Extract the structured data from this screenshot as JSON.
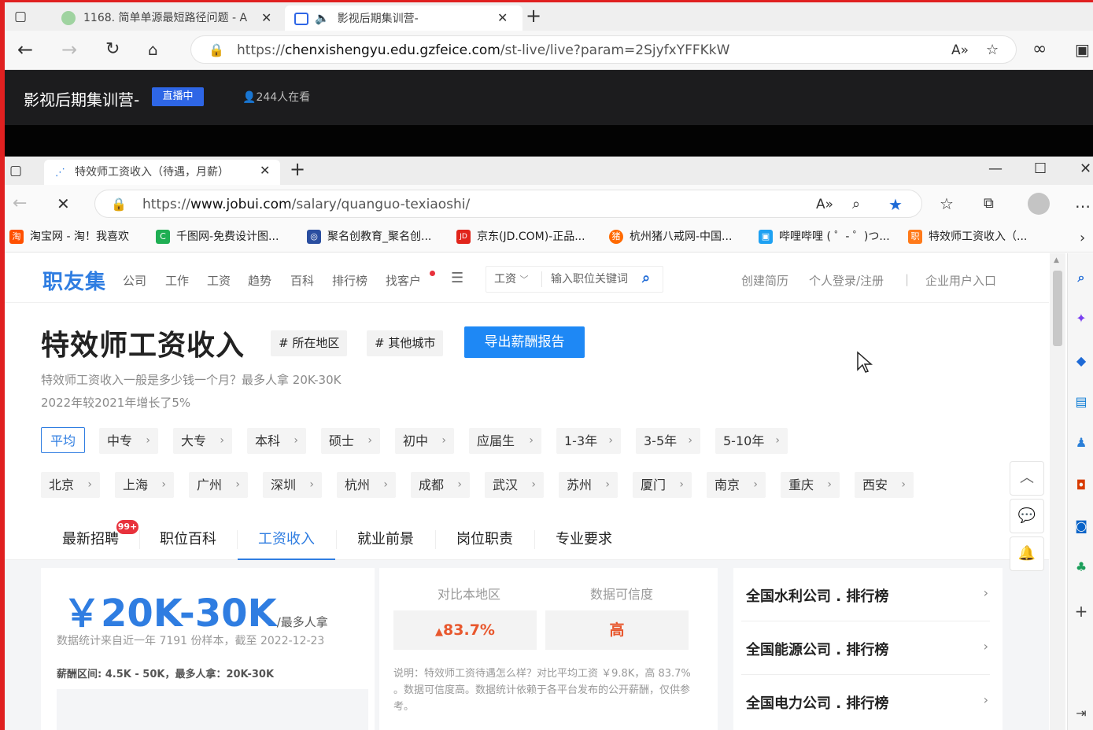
{
  "outer_browser": {
    "tabs": [
      {
        "title": "1168. 简单单源最短路径问题 - A",
        "active": false
      },
      {
        "title": "影视后期集训营-",
        "active": true
      }
    ],
    "url_prefix": "https://",
    "url_host": "chenxishengyu.edu.gzfeice.com",
    "url_path": "/st-live/live?param=2SjyfxYFFKkW"
  },
  "live_header": {
    "title": "影视后期集训营-",
    "status": "直播中",
    "viewers": "244人在看"
  },
  "inner_browser": {
    "tab_title": "特效师工资收入（待遇，月薪）",
    "url_prefix": "https://",
    "url_host": "www.jobui.com",
    "url_path": "/salary/quanguo-texiaoshi/",
    "bookmarks": [
      {
        "label": "淘宝网 - 淘！我喜欢",
        "icon": "taobao-icon",
        "color": "#ff5000",
        "glyph": "淘"
      },
      {
        "label": "千图网-免费设计图...",
        "icon": "qiantu-icon",
        "color": "#1fae53",
        "glyph": "C"
      },
      {
        "label": "聚名创教育_聚名创...",
        "icon": "juming-icon",
        "color": "#2a4ea0",
        "glyph": "◎"
      },
      {
        "label": "京东(JD.COM)-正品...",
        "icon": "jd-icon",
        "color": "#e1251b",
        "glyph": "JD"
      },
      {
        "label": "杭州猪八戒网-中国...",
        "icon": "zbj-icon",
        "color": "#ff6a00",
        "glyph": "猪"
      },
      {
        "label": "哔哩哔哩 ( ゜- ゜)つ...",
        "icon": "bilibili-icon",
        "color": "#1ea1f2",
        "glyph": "▣"
      },
      {
        "label": "特效师工资收入（...",
        "icon": "jobui-icon",
        "color": "#ff7a1a",
        "glyph": "职"
      }
    ]
  },
  "site": {
    "logo": "职友集",
    "nav": [
      "公司",
      "工作",
      "工资",
      "趋势",
      "百科",
      "排行榜",
      "找客户"
    ],
    "search_category": "工资",
    "search_placeholder": "输入职位关键词",
    "right_links": [
      "创建简历",
      "个人登录/注册",
      "企业用户入口"
    ],
    "right_sep": "|"
  },
  "hero": {
    "title": "特效师工资收入",
    "tag_region": "# 所在地区",
    "tag_other": "# 其他城市",
    "export_button": "导出薪酬报告",
    "desc1": "特效师工资收入一般是多少钱一个月？最多人拿 20K-30K",
    "desc2": "2022年较2021年增长了5%"
  },
  "edu_filters": [
    "平均",
    "中专",
    "大专",
    "本科",
    "硕士",
    "初中",
    "应届生",
    "1-3年",
    "3-5年",
    "5-10年"
  ],
  "city_filters": [
    "北京",
    "上海",
    "广州",
    "深圳",
    "杭州",
    "成都",
    "武汉",
    "苏州",
    "厦门",
    "南京",
    "重庆",
    "西安"
  ],
  "page_tabs": [
    "最新招聘",
    "职位百科",
    "工资收入",
    "就业前景",
    "岗位职责",
    "专业要求"
  ],
  "new_badge": "99+",
  "salary_card": {
    "amount": "￥20K-30K",
    "suffix": "/最多人拿",
    "source": "数据统计来自近一年 7191 份样本，截至 2022-12-23",
    "range": "薪酬区间: 4.5K - 50K，最多人拿：20K-30K"
  },
  "compare_card": {
    "head_local": "对比本地区",
    "head_cred": "数据可信度",
    "local_value": "83.7%",
    "cred_value": "高",
    "note": "说明：特效师工资待遇怎么样？对比平均工资 ￥9.8K，高 83.7% 。数据可信度高。数据统计依赖于各平台发布的公开薪酬，仅供参考。"
  },
  "rank_card": {
    "items": [
      "全国水利公司 . 排行榜",
      "全国能源公司 . 排行榜",
      "全国电力公司 . 排行榜"
    ]
  },
  "colors": {
    "brand_blue": "#2f7de1",
    "export_blue": "#1e88f5",
    "up_orange": "#e8572d",
    "live_badge": "#2e66e6"
  }
}
